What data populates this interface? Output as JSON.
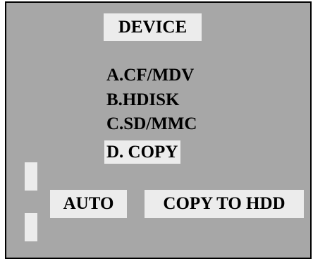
{
  "screen": {
    "title": "DEVICE",
    "menu": [
      {
        "label": "A.CF/MDV",
        "selected": false
      },
      {
        "label": "B.HDISK",
        "selected": false
      },
      {
        "label": "C.SD/MMC",
        "selected": false
      },
      {
        "label": "D. COPY",
        "selected": true
      }
    ],
    "buttons": {
      "auto": "AUTO",
      "copy_to_hdd": "COPY TO HDD"
    }
  },
  "colors": {
    "screen_background": "#a7a7a7",
    "highlight": "#ececec",
    "text": "#000000",
    "border": "#000000"
  }
}
